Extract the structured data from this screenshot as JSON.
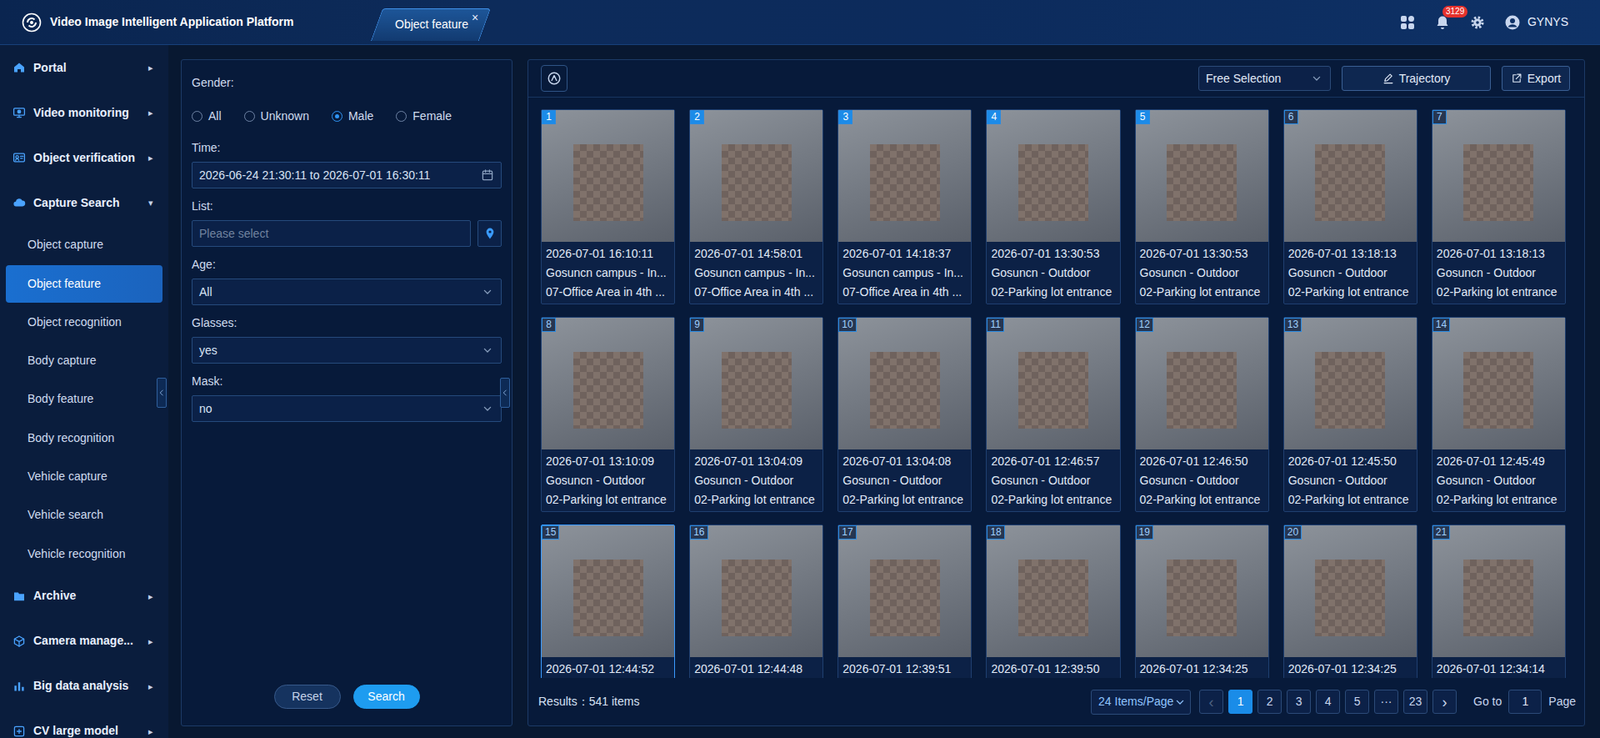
{
  "header": {
    "title": "Video Image Intelligent Application Platform",
    "tabs": [
      {
        "label": "Object feature",
        "close": "×",
        "selected": true
      }
    ],
    "notifications": "3129",
    "user": "GYNYS"
  },
  "sidebar": {
    "items": [
      {
        "label": "Portal",
        "arrow": "▸",
        "expanded": false,
        "children": []
      },
      {
        "label": "Video monitoring",
        "arrow": "▸",
        "expanded": false,
        "children": []
      },
      {
        "label": "Object verification",
        "arrow": "▸",
        "expanded": false,
        "children": []
      },
      {
        "label": "Capture Search",
        "arrow": "▾",
        "expanded": true,
        "children": [
          {
            "label": "Object capture",
            "selected": false
          },
          {
            "label": "Object feature",
            "selected": true
          },
          {
            "label": "Object recognition",
            "selected": false
          },
          {
            "label": "Body capture",
            "selected": false
          },
          {
            "label": "Body feature",
            "selected": false
          },
          {
            "label": "Body recognition",
            "selected": false
          },
          {
            "label": "Vehicle capture",
            "selected": false
          },
          {
            "label": "Vehicle search",
            "selected": false
          },
          {
            "label": "Vehicle recognition",
            "selected": false
          }
        ]
      },
      {
        "label": "Archive",
        "arrow": "▸",
        "expanded": false,
        "children": []
      },
      {
        "label": "Camera manage...",
        "arrow": "▸",
        "expanded": false,
        "children": []
      },
      {
        "label": "Big data analysis",
        "arrow": "▸",
        "expanded": false,
        "children": []
      },
      {
        "label": "CV large model",
        "arrow": "▸",
        "expanded": false,
        "children": []
      }
    ]
  },
  "filters": {
    "gender": {
      "label": "Gender:",
      "options": [
        {
          "label": "All",
          "selected": false
        },
        {
          "label": "Unknown",
          "selected": false
        },
        {
          "label": "Male",
          "selected": true
        },
        {
          "label": "Female",
          "selected": false
        }
      ]
    },
    "time": {
      "label": "Time:",
      "value": "2026-06-24 21:30:11 to 2026-07-01 16:30:11"
    },
    "list": {
      "label": "List:",
      "placeholder": "Please select"
    },
    "age": {
      "label": "Age:",
      "value": "All"
    },
    "glasses": {
      "label": "Glasses:",
      "value": "yes"
    },
    "mask": {
      "label": "Mask:",
      "value": "no"
    },
    "buttons": [
      {
        "label": "Reset",
        "kind": "secondary"
      },
      {
        "label": "Search",
        "kind": "primary"
      }
    ]
  },
  "toolbar": {
    "mode": "Free Selection",
    "buttons": [
      {
        "label": "Trajectory"
      },
      {
        "label": "Export"
      }
    ]
  },
  "results": {
    "cards": [
      {
        "number": "1",
        "marked": true,
        "selected": false,
        "time": "2026-07-01 16:10:11",
        "location": "Gosuncn campus - In...",
        "camera": "07-Office Area in 4th ..."
      },
      {
        "number": "2",
        "marked": true,
        "selected": false,
        "time": "2026-07-01 14:58:01",
        "location": "Gosuncn campus - In...",
        "camera": "07-Office Area in 4th ..."
      },
      {
        "number": "3",
        "marked": true,
        "selected": false,
        "time": "2026-07-01 14:18:37",
        "location": "Gosuncn campus - In...",
        "camera": "07-Office Area in 4th ..."
      },
      {
        "number": "4",
        "marked": true,
        "selected": false,
        "time": "2026-07-01 13:30:53",
        "location": "Gosuncn - Outdoor",
        "camera": "02-Parking lot entrance"
      },
      {
        "number": "5",
        "marked": true,
        "selected": false,
        "time": "2026-07-01 13:30:53",
        "location": "Gosuncn - Outdoor",
        "camera": "02-Parking lot entrance"
      },
      {
        "number": "6",
        "marked": false,
        "selected": false,
        "time": "2026-07-01 13:18:13",
        "location": "Gosuncn - Outdoor",
        "camera": "02-Parking lot entrance"
      },
      {
        "number": "7",
        "marked": false,
        "selected": false,
        "time": "2026-07-01 13:18:13",
        "location": "Gosuncn - Outdoor",
        "camera": "02-Parking lot entrance"
      },
      {
        "number": "8",
        "marked": false,
        "selected": false,
        "time": "2026-07-01 13:10:09",
        "location": "Gosuncn - Outdoor",
        "camera": "02-Parking lot entrance"
      },
      {
        "number": "9",
        "marked": false,
        "selected": false,
        "time": "2026-07-01 13:04:09",
        "location": "Gosuncn - Outdoor",
        "camera": "02-Parking lot entrance"
      },
      {
        "number": "10",
        "marked": false,
        "selected": false,
        "time": "2026-07-01 13:04:08",
        "location": "Gosuncn - Outdoor",
        "camera": "02-Parking lot entrance"
      },
      {
        "number": "11",
        "marked": false,
        "selected": false,
        "time": "2026-07-01 12:46:57",
        "location": "Gosuncn - Outdoor",
        "camera": "02-Parking lot entrance"
      },
      {
        "number": "12",
        "marked": false,
        "selected": false,
        "time": "2026-07-01 12:46:50",
        "location": "Gosuncn - Outdoor",
        "camera": "02-Parking lot entrance"
      },
      {
        "number": "13",
        "marked": false,
        "selected": false,
        "time": "2026-07-01 12:45:50",
        "location": "Gosuncn - Outdoor",
        "camera": "02-Parking lot entrance"
      },
      {
        "number": "14",
        "marked": false,
        "selected": false,
        "time": "2026-07-01 12:45:49",
        "location": "Gosuncn - Outdoor",
        "camera": "02-Parking lot entrance"
      },
      {
        "number": "15",
        "marked": false,
        "selected": true,
        "time": "2026-07-01 12:44:52"
      },
      {
        "number": "16",
        "marked": false,
        "selected": false,
        "time": "2026-07-01 12:44:48"
      },
      {
        "number": "17",
        "marked": false,
        "selected": false,
        "time": "2026-07-01 12:39:51"
      },
      {
        "number": "18",
        "marked": false,
        "selected": false,
        "time": "2026-07-01 12:39:50"
      },
      {
        "number": "19",
        "marked": false,
        "selected": false,
        "time": "2026-07-01 12:34:25"
      },
      {
        "number": "20",
        "marked": false,
        "selected": false,
        "time": "2026-07-01 12:34:25"
      },
      {
        "number": "21",
        "marked": false,
        "selected": false,
        "time": "2026-07-01 12:34:14"
      }
    ],
    "summary": "Results：541 items",
    "page_size": "24 Items/Page",
    "prev": {
      "label": "‹",
      "disabled": true
    },
    "next": {
      "label": "›",
      "disabled": false
    },
    "pages": [
      {
        "label": "1",
        "selected": true
      },
      {
        "label": "2",
        "selected": false
      },
      {
        "label": "3",
        "selected": false
      },
      {
        "label": "4",
        "selected": false
      },
      {
        "label": "5",
        "selected": false
      },
      {
        "label": "···",
        "selected": false
      },
      {
        "label": "23",
        "selected": false
      }
    ],
    "goto": {
      "label": "Go to",
      "value": "1",
      "suffix": "Page"
    }
  }
}
